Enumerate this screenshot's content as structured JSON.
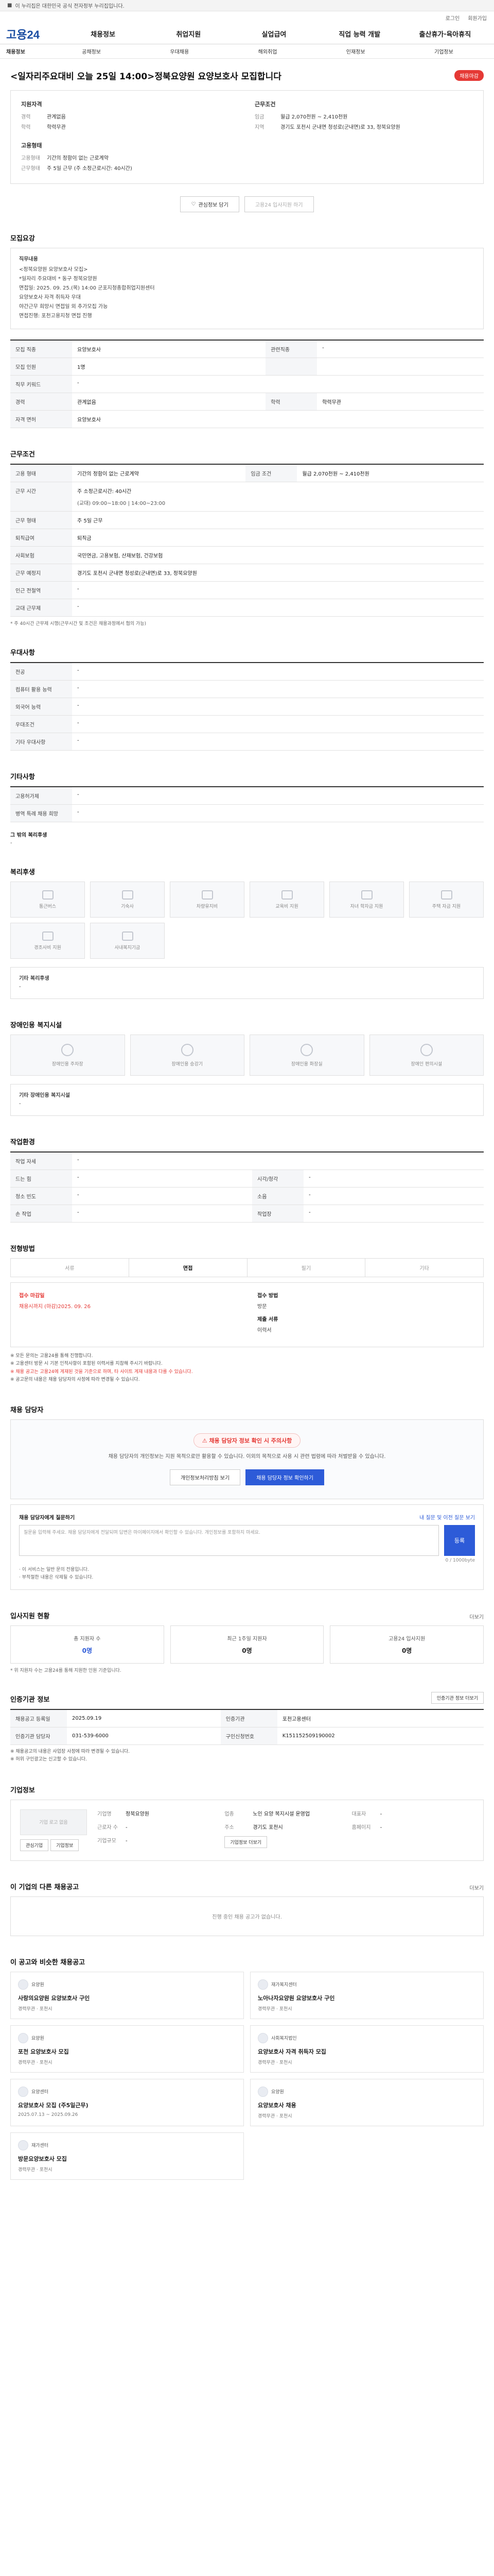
{
  "topbar": {
    "notice": "이 누리집은 대한민국 공식 전자정부 누리집입니다."
  },
  "util": [
    "로그인",
    "회원가입"
  ],
  "logo": "고용24",
  "gnb": [
    "채용정보",
    "취업지원",
    "실업급여",
    "직업 능력 개발",
    "출산휴가·육아휴직"
  ],
  "subnav": [
    "채용정보",
    "공채정보",
    "우대채용",
    "해외취업",
    "인재정보",
    "기업정보"
  ],
  "job": {
    "title": "<일자리주요대비 오늘 25일 14:00>정북요양원 요양보호사 모집합니다",
    "badge": "채용마감",
    "summary_left_h": "지원자격",
    "summary_left": [
      {
        "k": "경력",
        "v": "관계없음"
      },
      {
        "k": "학력",
        "v": "학력무관"
      }
    ],
    "summary_right_h": "근무조건",
    "summary_right": [
      {
        "k": "임금",
        "v": "월급 2,070천원 ~ 2,410천원"
      },
      {
        "k": "지역",
        "v": "경기도 포천시 군내면 청성로(군내면)로 33, 정북요양원"
      }
    ],
    "summary_lower_h": "고용형태",
    "summary_lower": [
      {
        "k": "고용형태",
        "v": "기간의 정함이 없는 근로계약"
      },
      {
        "k": "근무형태",
        "v": "주 5일 근무 (주 소정근로시간: 40시간)"
      }
    ],
    "btn_scrap": "관심정보 담기",
    "btn_similar": "고용24 입사지원 하기"
  },
  "recruit_section": {
    "title": "모집요강",
    "label": "직무내용",
    "lines": [
      "<정북요양원 요양보호사 모집>",
      "*일자리 주요대비 * 동구 정북요양원",
      "면접일: 2025. 09. 25.(목) 14:00 군포지청종합취업지원센터",
      "요양보호사 자격 취득자 우대",
      "야간근무 희망시 면접일 외 추가모집 가능",
      "면접진행: 포천고용지청 면접 진행"
    ],
    "rows": [
      {
        "k": "모집 직종",
        "v": "요양보호사",
        "k2": "관련직종",
        "v2": "-"
      },
      {
        "k": "모집 인원",
        "v": "1명",
        "k2": "",
        "v2": ""
      },
      {
        "k": "직무 키워드",
        "v": "-",
        "k2": "",
        "v2": ""
      },
      {
        "k": "경력",
        "v": "관계없음",
        "k2": "학력",
        "v2": "학력무관"
      },
      {
        "k": "자격 면허",
        "v": "요양보호사",
        "k2": "",
        "v2": ""
      }
    ]
  },
  "conditions": {
    "title": "근무조건",
    "rows": [
      {
        "k": "고용 형태",
        "v": "기간의 정함이 없는 근로계약",
        "k2": "임금 조건",
        "v2": "월급 2,070천원 ~ 2,410천원"
      },
      {
        "k": "근무 시간",
        "v": "주 소정근로시간: 40시간",
        "k2": "",
        "v2": ""
      },
      {
        "k": "근무 형태",
        "v": "주 5일 근무",
        "k2": "",
        "v2": ""
      },
      {
        "k": "퇴직급여",
        "v": "퇴직금",
        "k2": "",
        "v2": ""
      },
      {
        "k": "사회보험",
        "v": "국민연금, 고용보험, 산재보험, 건강보험",
        "k2": "",
        "v2": ""
      },
      {
        "k": "근무 예정지",
        "v": "경기도 포천시 군내면 청성로(군내면)로 33, 정북요양원",
        "k2": "",
        "v2": ""
      },
      {
        "k": "인근 전철역",
        "v": "-",
        "k2": "",
        "v2": ""
      },
      {
        "k": "교대 근무제",
        "v": "-",
        "k2": "",
        "v2": ""
      }
    ],
    "work_time_detail": "(교대) 09:00~18:00 | 14:00~23:00",
    "note": "* 주 40시간 근무제 시행(근무시간 및 조건은 채용과정에서 협의 가능)"
  },
  "preferences": {
    "title": "우대사항",
    "rows": [
      {
        "k": "전공",
        "v": "-"
      },
      {
        "k": "컴퓨터 활용 능력",
        "v": "-"
      },
      {
        "k": "외국어 능력",
        "v": "-"
      },
      {
        "k": "우대조건",
        "v": "-"
      },
      {
        "k": "기타 우대사항",
        "v": "-"
      }
    ]
  },
  "others": {
    "title": "기타사항",
    "rows": [
      {
        "k": "고용허가제",
        "v": "-"
      },
      {
        "k": "병역 특례 채용 희망",
        "v": "-"
      }
    ],
    "extra_title": "그 밖의 복리후생",
    "extra_value": "-"
  },
  "welfare": {
    "title": "복리후생",
    "items": [
      "통근버스",
      "기숙사",
      "차량유지비",
      "교육비 지원",
      "자녀 학자금 지원",
      "주택 자금 지원",
      "경조사비 지원",
      "사내복지기금"
    ],
    "other_title": "기타 복리후생",
    "other_value": "-"
  },
  "disability": {
    "title": "장애인용 복지시설",
    "items": [
      "장애인용 주차장",
      "장애인용 승강기",
      "장애인용 화장실",
      "장애인 편의시설"
    ],
    "other_title": "기타 장애인용 복지시설",
    "other_value": "-"
  },
  "hours": {
    "title": "작업환경",
    "rows": [
      {
        "k": "작업 자세",
        "v": "-",
        "k2": "",
        "v2": ""
      },
      {
        "k": "드는 힘",
        "v": "-",
        "k2": "시각/청각",
        "v2": "-"
      },
      {
        "k": "청소 빈도",
        "v": "-",
        "k2": "소음",
        "v2": "-"
      },
      {
        "k": "손 작업",
        "v": "-",
        "k2": "작업장",
        "v2": "-"
      }
    ]
  },
  "method": {
    "title": "전형방법",
    "tabs": [
      "서류",
      "면접",
      "필기",
      "기타"
    ],
    "active_tab": 1,
    "apply_label": "접수 마감일",
    "apply_value": "채용시까지 (마감)2025. 09. 26",
    "apply_method_label": "접수 방법",
    "apply_method_value": "방문",
    "docs_label": "제출 서류",
    "docs_value": "이력서",
    "bullets": [
      "※ 모든 문의는 고용24를 통해 진행합니다.",
      "※ 고용센터 방문 시 기본 인적사항이 포함된 이력서를 지참해 주시기 바랍니다.",
      "※ 채용 공고는 고용24에 게재된 것을 기준으로 하며, 타 사이트 게재 내용과 다를 수 있습니다.",
      "※ 공고문의 내용은 채용 담당자의 사정에 따라 변경될 수 있습니다."
    ]
  },
  "contact": {
    "title": "채용 담당자",
    "warn": "채용 담당자 정보 확인 시 주의사항",
    "desc": "채용 담당자의 개인정보는 지원 목적으로만 활용할 수 있습니다. 이외의 목적으로 사용 시 관련 법령에 따라 처벌받을 수 있습니다.",
    "btn_left": "개인정보처리방침 보기",
    "btn_right": "채용 담당자 정보 확인하기"
  },
  "inquiry": {
    "head": "채용 담당자에게 질문하기",
    "link": "내 질문 및 이전 질문 보기",
    "placeholder": "질문을 입력해 주세요. 채용 담당자에게 전달되며 답변은 마이페이지에서 확인할 수 있습니다. 개인정보를 포함하지 마세요.",
    "btn": "등록",
    "count": "0 / 1000byte",
    "notes": [
      "· 이 서비스는 일반 문의 전용입니다.",
      "· 부적절한 내용은 삭제될 수 있습니다."
    ]
  },
  "status": {
    "title": "입사지원 현황",
    "more": "더보기",
    "cards": [
      {
        "t": "총 지원자 수",
        "n": "0명"
      },
      {
        "t": "최근 1주일 지원자",
        "n": "0명"
      },
      {
        "t": "고용24 입사지원",
        "n": "0명"
      }
    ],
    "note": "* 위 지원자 수는 고용24를 통해 지원한 인원 기준입니다."
  },
  "agency": {
    "title": "인증기관 정보",
    "more": "인증기관 정보 더보기",
    "rows": [
      {
        "k": "채용공고 등록일",
        "v": "2025.09.19",
        "k2": "인증기관",
        "v2": "포천고용센터"
      },
      {
        "k": "인증기관 담당자",
        "v": "031-539-6000",
        "k2": "구인신청번호",
        "v2": "K151152509190002"
      }
    ],
    "notes": [
      "※ 채용공고의 내용은 사업장 사정에 따라 변경될 수 있습니다.",
      "※ 허위 구인광고는 신고할 수 있습니다."
    ]
  },
  "company": {
    "title": "기업정보",
    "logo_text": "기업 로고 없음",
    "btns": [
      "관심기업",
      "기업정보"
    ],
    "rows": [
      {
        "k": "기업명",
        "v": "정북요양원"
      },
      {
        "k": "업종",
        "v": "노인 요양 복지시설 운영업"
      },
      {
        "k": "대표자",
        "v": "-"
      },
      {
        "k": "근로자 수",
        "v": "-"
      },
      {
        "k": "주소",
        "v": "경기도 포천시"
      },
      {
        "k": "홈페이지",
        "v": "-"
      },
      {
        "k": "기업규모",
        "v": "-"
      }
    ],
    "btn_more": "기업정보 더보기"
  },
  "other_jobs": {
    "title": "이 기업의 다른 채용공고",
    "empty": "진행 중인 채용 공고가 없습니다.",
    "more": "더보기"
  },
  "recommend": {
    "title": "이 공고와 비슷한 채용공고",
    "cards": [
      {
        "org": "요양원",
        "title": "사랑의요양원 요양보호사 구인",
        "meta": "경력무관 · 포천시"
      },
      {
        "org": "재가복지센터",
        "title": "노아나자요양원 요양보호사 구인",
        "meta": "경력무관 · 포천시"
      },
      {
        "org": "요양원",
        "title": "포천 요양보호사 모집",
        "meta": "경력무관 · 포천시"
      },
      {
        "org": "사회복지법인",
        "title": "요양보호사 자격 취득자 모집",
        "meta": "경력무관 · 포천시"
      },
      {
        "org": "요양센터",
        "title": "요양보호사 모집 (주5일근무)",
        "meta": "2025.07.13 ~ 2025.09.26"
      },
      {
        "org": "요양원",
        "title": "요양보호사 채용",
        "meta": "경력무관 · 포천시"
      },
      {
        "org": "재가센터",
        "title": "방문요양보호사 모집",
        "meta": "경력무관 · 포천시"
      }
    ]
  }
}
